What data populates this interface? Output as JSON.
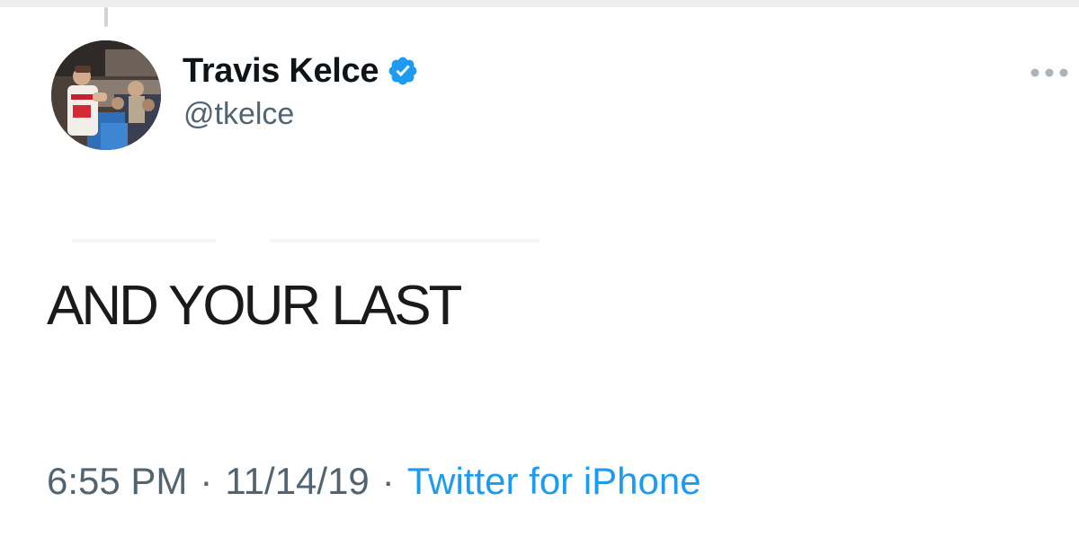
{
  "tweet": {
    "author": {
      "display_name": "Travis Kelce",
      "handle": "@tkelce",
      "verified": true,
      "verified_icon": "verified-badge-icon",
      "avatar": "profile-photo"
    },
    "more_icon": "more-options-icon",
    "text": "AND YOUR LAST",
    "meta": {
      "time": "6:55 PM",
      "separator": "·",
      "date": "11/14/19",
      "source": "Twitter for iPhone"
    }
  },
  "colors": {
    "text_primary": "#0f1419",
    "text_secondary": "#536471",
    "link": "#1d9bf0",
    "verified": "#1d9bf0"
  }
}
